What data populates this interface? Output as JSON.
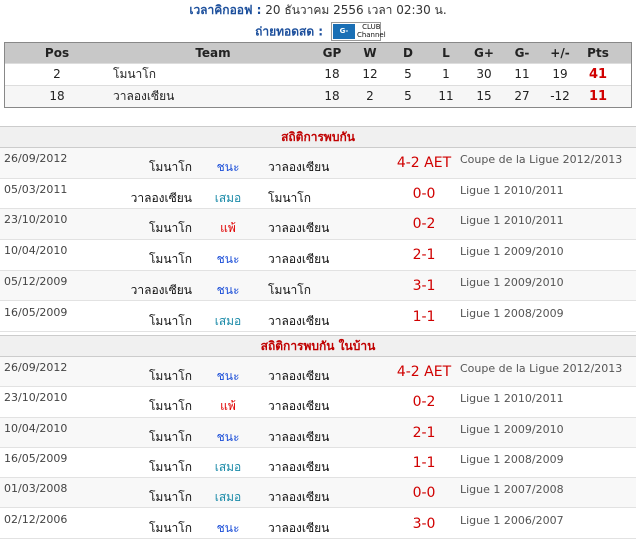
{
  "header": {
    "kickoff_label": "เวลาคิกออฟ :",
    "kickoff_value": "20 ธันวาคม 2556 เวลา 02:30 น.",
    "live_label": "ถ่ายทอดสด :",
    "channel_logo_text": "G-MM",
    "channel_logo_sub": "CLUB",
    "channel_logo_sub2": "Channel"
  },
  "standings": {
    "columns": [
      "Pos",
      "Team",
      "GP",
      "W",
      "D",
      "L",
      "G+",
      "G-",
      "+/-",
      "Pts"
    ],
    "rows": [
      {
        "pos": "2",
        "team": "โมนาโก",
        "gp": "18",
        "w": "12",
        "d": "5",
        "l": "1",
        "gf": "30",
        "ga": "11",
        "gd": "19",
        "pts": "41"
      },
      {
        "pos": "18",
        "team": "วาลองเซียน",
        "gp": "18",
        "w": "2",
        "d": "5",
        "l": "11",
        "gf": "15",
        "ga": "27",
        "gd": "-12",
        "pts": "11"
      }
    ]
  },
  "colors": {
    "win": "#1c4fd8",
    "draw": "#1a8aa8",
    "loss": "#e00000",
    "score": "#d00000"
  },
  "head_to_head": {
    "title": "สถิติการพบกัน",
    "matches": [
      {
        "date": "26/09/2012",
        "home": "โมนาโก",
        "result": "ชนะ",
        "rtype": "win",
        "away": "วาลองเซียน",
        "score": "4-2 AET",
        "comp": "Coupe de la Ligue 2012/2013"
      },
      {
        "date": "05/03/2011",
        "home": "วาลองเซียน",
        "result": "เสมอ",
        "rtype": "draw",
        "away": "โมนาโก",
        "score": "0-0",
        "comp": "Ligue 1 2010/2011"
      },
      {
        "date": "23/10/2010",
        "home": "โมนาโก",
        "result": "แพ้",
        "rtype": "loss",
        "away": "วาลองเซียน",
        "score": "0-2",
        "comp": "Ligue 1 2010/2011"
      },
      {
        "date": "10/04/2010",
        "home": "โมนาโก",
        "result": "ชนะ",
        "rtype": "win",
        "away": "วาลองเซียน",
        "score": "2-1",
        "comp": "Ligue 1 2009/2010"
      },
      {
        "date": "05/12/2009",
        "home": "วาลองเซียน",
        "result": "ชนะ",
        "rtype": "win",
        "away": "โมนาโก",
        "score": "3-1",
        "comp": "Ligue 1 2009/2010"
      },
      {
        "date": "16/05/2009",
        "home": "โมนาโก",
        "result": "เสมอ",
        "rtype": "draw",
        "away": "วาลองเซียน",
        "score": "1-1",
        "comp": "Ligue 1 2008/2009"
      }
    ]
  },
  "home_head_to_head": {
    "title": "สถิติการพบกัน ในบ้าน",
    "matches": [
      {
        "date": "26/09/2012",
        "home": "โมนาโก",
        "result": "ชนะ",
        "rtype": "win",
        "away": "วาลองเซียน",
        "score": "4-2 AET",
        "comp": "Coupe de la Ligue 2012/2013"
      },
      {
        "date": "23/10/2010",
        "home": "โมนาโก",
        "result": "แพ้",
        "rtype": "loss",
        "away": "วาลองเซียน",
        "score": "0-2",
        "comp": "Ligue 1 2010/2011"
      },
      {
        "date": "10/04/2010",
        "home": "โมนาโก",
        "result": "ชนะ",
        "rtype": "win",
        "away": "วาลองเซียน",
        "score": "2-1",
        "comp": "Ligue 1 2009/2010"
      },
      {
        "date": "16/05/2009",
        "home": "โมนาโก",
        "result": "เสมอ",
        "rtype": "draw",
        "away": "วาลองเซียน",
        "score": "1-1",
        "comp": "Ligue 1 2008/2009"
      },
      {
        "date": "01/03/2008",
        "home": "โมนาโก",
        "result": "เสมอ",
        "rtype": "draw",
        "away": "วาลองเซียน",
        "score": "0-0",
        "comp": "Ligue 1 2007/2008"
      },
      {
        "date": "02/12/2006",
        "home": "โมนาโก",
        "result": "ชนะ",
        "rtype": "win",
        "away": "วาลองเซียน",
        "score": "3-0",
        "comp": "Ligue 1 2006/2007"
      }
    ]
  }
}
